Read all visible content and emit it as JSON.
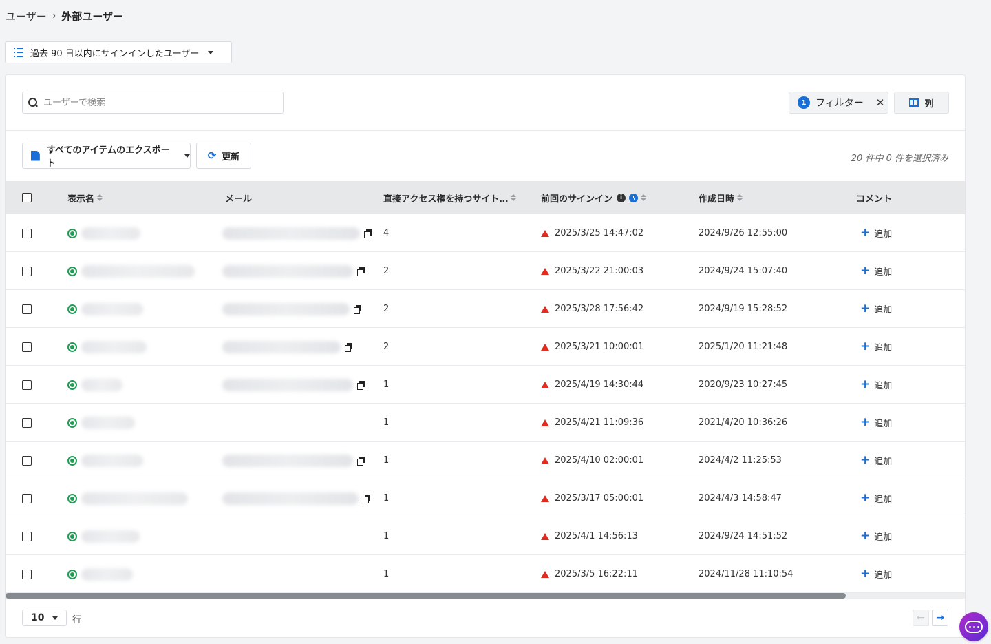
{
  "breadcrumb": {
    "root": "ユーザー",
    "separator": "›",
    "current": "外部ユーザー"
  },
  "view_selector": {
    "label": "過去 90 日以内にサインインしたユーザー"
  },
  "search": {
    "placeholder": "ユーザーで検索",
    "value": ""
  },
  "filter": {
    "count": "1",
    "label": "フィルター",
    "clear": "✕"
  },
  "columns_button": {
    "label": "列"
  },
  "toolbar": {
    "export_label": "すべてのアイテムのエクスポート",
    "refresh_label": "更新",
    "refresh_icon": "⟳"
  },
  "selection_summary": "20 件中 0 件を選択済み",
  "table": {
    "headers": {
      "display_name": "表示名",
      "email": "メール",
      "sites": "直接アクセス権を持つサイト…",
      "last_signin": "前回のサインイン",
      "created": "作成日時",
      "comment": "コメント"
    },
    "info_glyph": "i",
    "add_label": "追加",
    "add_icon": "+",
    "rows": [
      {
        "sites": "4",
        "last_signin": "2025/3/25 14:47:02",
        "created": "2024/9/26 12:55:00"
      },
      {
        "sites": "2",
        "last_signin": "2025/3/22 21:00:03",
        "created": "2024/9/24 15:07:40"
      },
      {
        "sites": "2",
        "last_signin": "2025/3/28 17:56:42",
        "created": "2024/9/19 15:28:52"
      },
      {
        "sites": "2",
        "last_signin": "2025/3/21 10:00:01",
        "created": "2025/1/20 11:21:48"
      },
      {
        "sites": "1",
        "last_signin": "2025/4/19 14:30:44",
        "created": "2020/9/23 10:27:45"
      },
      {
        "sites": "1",
        "last_signin": "2025/4/21 11:09:36",
        "created": "2021/4/20 10:36:26"
      },
      {
        "sites": "1",
        "last_signin": "2025/4/10 02:00:01",
        "created": "2024/4/2 11:25:53"
      },
      {
        "sites": "1",
        "last_signin": "2025/3/17 05:00:01",
        "created": "2024/4/3 14:58:47"
      },
      {
        "sites": "1",
        "last_signin": "2025/4/1 14:56:13",
        "created": "2024/9/24 14:51:52"
      },
      {
        "sites": "1",
        "last_signin": "2025/3/5 16:22:11",
        "created": "2024/11/28 11:10:54"
      }
    ]
  },
  "pagination": {
    "page_size": "10",
    "rows_label": "行",
    "prev": "←",
    "next": "→"
  },
  "colors": {
    "accent": "#1a6fd6",
    "status_ok": "#1f9d55",
    "warning": "#e02b20",
    "chat": "#8a2bd0"
  }
}
